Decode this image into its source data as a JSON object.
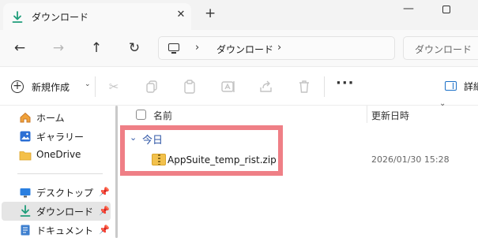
{
  "tab": {
    "title": "ダウンロード",
    "close": "✕",
    "new": "+"
  },
  "window": {
    "minimize": "—"
  },
  "nav": {
    "back": "←",
    "forward": "→",
    "up": "↑",
    "refresh": "↻",
    "sep": "›",
    "breadcrumb": "ダウンロード",
    "search_placeholder": "ダウンロード"
  },
  "toolbar": {
    "new_label": "新規作成",
    "new_chevron": "⌄",
    "more": "···",
    "details_label": "詳細"
  },
  "sidebar": {
    "items": [
      {
        "label": "ホーム"
      },
      {
        "label": "ギャラリー"
      },
      {
        "label": "OneDrive"
      },
      {
        "label": "デスクトップ"
      },
      {
        "label": "ダウンロード"
      },
      {
        "label": "ドキュメント"
      }
    ],
    "pin": "📌"
  },
  "columns": {
    "name": "名前",
    "date": "更新日時",
    "sort_indicator": "⌄"
  },
  "group": {
    "chevron": "⌄",
    "label": "今日"
  },
  "files": [
    {
      "name": "AppSuite_temp_rist.zip",
      "date": "2026/01/30 15:28",
      "icon": "zip-folder-icon"
    }
  ],
  "colors": {
    "highlight": "#ef7f86",
    "group": "#2f56a6",
    "accent": "#1a6fc7"
  }
}
